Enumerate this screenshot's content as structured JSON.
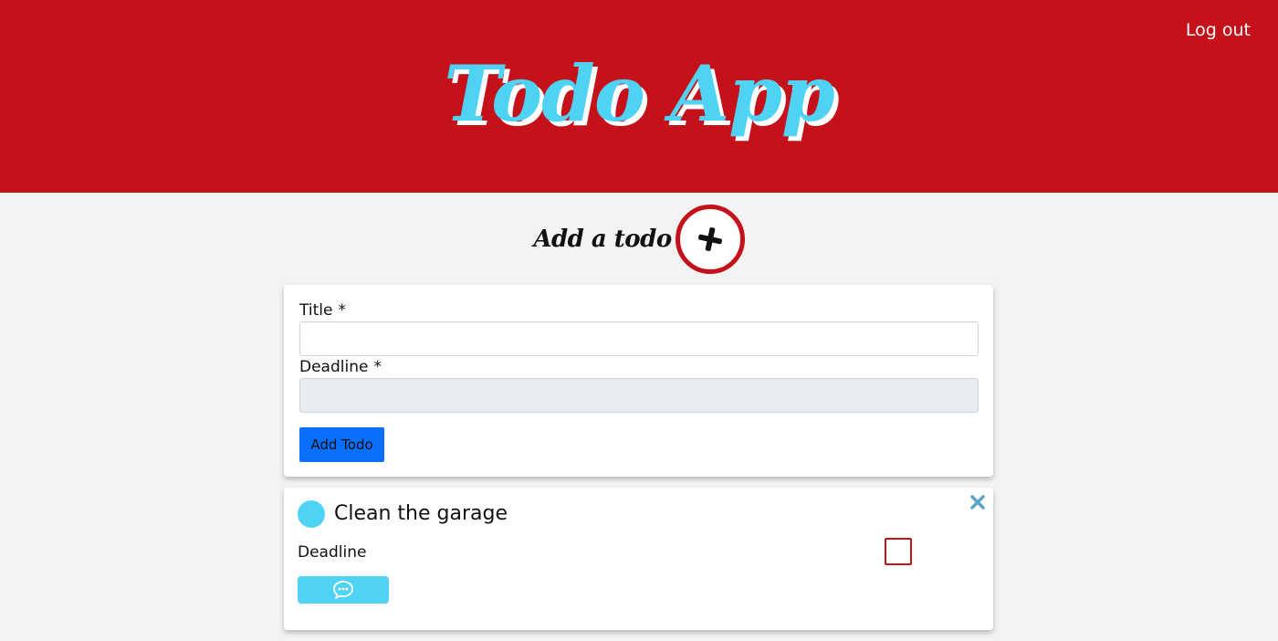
{
  "header": {
    "title": "Todo App",
    "logout_label": "Log out",
    "colors": {
      "background": "#c4111a",
      "title": "#4fd3f5"
    }
  },
  "add_section": {
    "label": "Add a todo",
    "toggle_icon": "plus-icon"
  },
  "form": {
    "title_label": "Title",
    "title_required": "*",
    "title_value": "",
    "deadline_label": "Deadline",
    "deadline_required": "*",
    "deadline_value": "",
    "submit_label": "Add Todo",
    "submit_color": "#0a6efb"
  },
  "todos": [
    {
      "title": "Clean the garage",
      "deadline_label": "Deadline",
      "status_color": "#4fd3f5",
      "close_icon": "close-icon",
      "comment_icon": "comment-bubble-icon",
      "completed": false
    }
  ]
}
